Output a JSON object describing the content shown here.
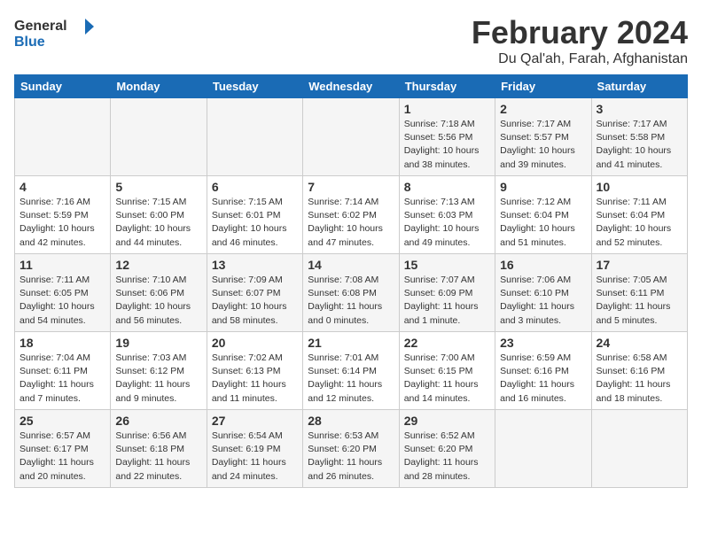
{
  "logo": {
    "line1": "General",
    "line2": "Blue"
  },
  "title": "February 2024",
  "subtitle": "Du Qal'ah, Farah, Afghanistan",
  "days_of_week": [
    "Sunday",
    "Monday",
    "Tuesday",
    "Wednesday",
    "Thursday",
    "Friday",
    "Saturday"
  ],
  "weeks": [
    [
      {
        "day": "",
        "info": ""
      },
      {
        "day": "",
        "info": ""
      },
      {
        "day": "",
        "info": ""
      },
      {
        "day": "",
        "info": ""
      },
      {
        "day": "1",
        "info": "Sunrise: 7:18 AM\nSunset: 5:56 PM\nDaylight: 10 hours\nand 38 minutes."
      },
      {
        "day": "2",
        "info": "Sunrise: 7:17 AM\nSunset: 5:57 PM\nDaylight: 10 hours\nand 39 minutes."
      },
      {
        "day": "3",
        "info": "Sunrise: 7:17 AM\nSunset: 5:58 PM\nDaylight: 10 hours\nand 41 minutes."
      }
    ],
    [
      {
        "day": "4",
        "info": "Sunrise: 7:16 AM\nSunset: 5:59 PM\nDaylight: 10 hours\nand 42 minutes."
      },
      {
        "day": "5",
        "info": "Sunrise: 7:15 AM\nSunset: 6:00 PM\nDaylight: 10 hours\nand 44 minutes."
      },
      {
        "day": "6",
        "info": "Sunrise: 7:15 AM\nSunset: 6:01 PM\nDaylight: 10 hours\nand 46 minutes."
      },
      {
        "day": "7",
        "info": "Sunrise: 7:14 AM\nSunset: 6:02 PM\nDaylight: 10 hours\nand 47 minutes."
      },
      {
        "day": "8",
        "info": "Sunrise: 7:13 AM\nSunset: 6:03 PM\nDaylight: 10 hours\nand 49 minutes."
      },
      {
        "day": "9",
        "info": "Sunrise: 7:12 AM\nSunset: 6:04 PM\nDaylight: 10 hours\nand 51 minutes."
      },
      {
        "day": "10",
        "info": "Sunrise: 7:11 AM\nSunset: 6:04 PM\nDaylight: 10 hours\nand 52 minutes."
      }
    ],
    [
      {
        "day": "11",
        "info": "Sunrise: 7:11 AM\nSunset: 6:05 PM\nDaylight: 10 hours\nand 54 minutes."
      },
      {
        "day": "12",
        "info": "Sunrise: 7:10 AM\nSunset: 6:06 PM\nDaylight: 10 hours\nand 56 minutes."
      },
      {
        "day": "13",
        "info": "Sunrise: 7:09 AM\nSunset: 6:07 PM\nDaylight: 10 hours\nand 58 minutes."
      },
      {
        "day": "14",
        "info": "Sunrise: 7:08 AM\nSunset: 6:08 PM\nDaylight: 11 hours\nand 0 minutes."
      },
      {
        "day": "15",
        "info": "Sunrise: 7:07 AM\nSunset: 6:09 PM\nDaylight: 11 hours\nand 1 minute."
      },
      {
        "day": "16",
        "info": "Sunrise: 7:06 AM\nSunset: 6:10 PM\nDaylight: 11 hours\nand 3 minutes."
      },
      {
        "day": "17",
        "info": "Sunrise: 7:05 AM\nSunset: 6:11 PM\nDaylight: 11 hours\nand 5 minutes."
      }
    ],
    [
      {
        "day": "18",
        "info": "Sunrise: 7:04 AM\nSunset: 6:11 PM\nDaylight: 11 hours\nand 7 minutes."
      },
      {
        "day": "19",
        "info": "Sunrise: 7:03 AM\nSunset: 6:12 PM\nDaylight: 11 hours\nand 9 minutes."
      },
      {
        "day": "20",
        "info": "Sunrise: 7:02 AM\nSunset: 6:13 PM\nDaylight: 11 hours\nand 11 minutes."
      },
      {
        "day": "21",
        "info": "Sunrise: 7:01 AM\nSunset: 6:14 PM\nDaylight: 11 hours\nand 12 minutes."
      },
      {
        "day": "22",
        "info": "Sunrise: 7:00 AM\nSunset: 6:15 PM\nDaylight: 11 hours\nand 14 minutes."
      },
      {
        "day": "23",
        "info": "Sunrise: 6:59 AM\nSunset: 6:16 PM\nDaylight: 11 hours\nand 16 minutes."
      },
      {
        "day": "24",
        "info": "Sunrise: 6:58 AM\nSunset: 6:16 PM\nDaylight: 11 hours\nand 18 minutes."
      }
    ],
    [
      {
        "day": "25",
        "info": "Sunrise: 6:57 AM\nSunset: 6:17 PM\nDaylight: 11 hours\nand 20 minutes."
      },
      {
        "day": "26",
        "info": "Sunrise: 6:56 AM\nSunset: 6:18 PM\nDaylight: 11 hours\nand 22 minutes."
      },
      {
        "day": "27",
        "info": "Sunrise: 6:54 AM\nSunset: 6:19 PM\nDaylight: 11 hours\nand 24 minutes."
      },
      {
        "day": "28",
        "info": "Sunrise: 6:53 AM\nSunset: 6:20 PM\nDaylight: 11 hours\nand 26 minutes."
      },
      {
        "day": "29",
        "info": "Sunrise: 6:52 AM\nSunset: 6:20 PM\nDaylight: 11 hours\nand 28 minutes."
      },
      {
        "day": "",
        "info": ""
      },
      {
        "day": "",
        "info": ""
      }
    ]
  ]
}
